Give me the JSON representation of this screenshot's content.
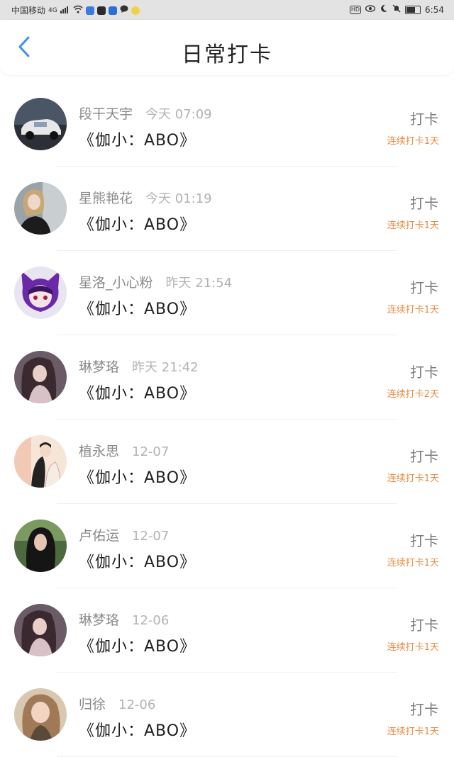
{
  "status_bar": {
    "carrier": "中国移动",
    "network": "4G",
    "time": "6:54",
    "hd_badge": "HD"
  },
  "header": {
    "back_icon": "chevron-left-icon",
    "title": "日常打卡",
    "accent_color": "#3d8ff5"
  },
  "entries": [
    {
      "name": "段干天宇",
      "time": "今天 07:09",
      "book": "《伽小：ABO》",
      "action": "打卡",
      "streak": "连续打卡1天",
      "avatar": "car-photo"
    },
    {
      "name": "星熊艳花",
      "time": "今天 01:19",
      "book": "《伽小：ABO》",
      "action": "打卡",
      "streak": "连续打卡1天",
      "avatar": "girl-portrait"
    },
    {
      "name": "星洛_小心粉",
      "time": "昨天 21:54",
      "book": "《伽小：ABO》",
      "action": "打卡",
      "streak": "连续打卡1天",
      "avatar": "anime-purple-cat"
    },
    {
      "name": "琳梦珞",
      "time": "昨天 21:42",
      "book": "《伽小：ABO》",
      "action": "打卡",
      "streak": "连续打卡2天",
      "avatar": "anime-girl"
    },
    {
      "name": "植永思",
      "time": "12-07",
      "book": "《伽小：ABO》",
      "action": "打卡",
      "streak": "连续打卡1天",
      "avatar": "anime-couple"
    },
    {
      "name": "卢佑运",
      "time": "12-07",
      "book": "《伽小：ABO》",
      "action": "打卡",
      "streak": "连续打卡1天",
      "avatar": "girl-dark-hair"
    },
    {
      "name": "琳梦珞",
      "time": "12-06",
      "book": "《伽小：ABO》",
      "action": "打卡",
      "streak": "连续打卡1天",
      "avatar": "anime-girl"
    },
    {
      "name": "归徐",
      "time": "12-06",
      "book": "《伽小：ABO》",
      "action": "打卡",
      "streak": "连续打卡1天",
      "avatar": "girl-light-hair"
    }
  ],
  "colors": {
    "streak": "#e88c45",
    "name": "#8a8a8a",
    "time": "#b3b3b3"
  }
}
